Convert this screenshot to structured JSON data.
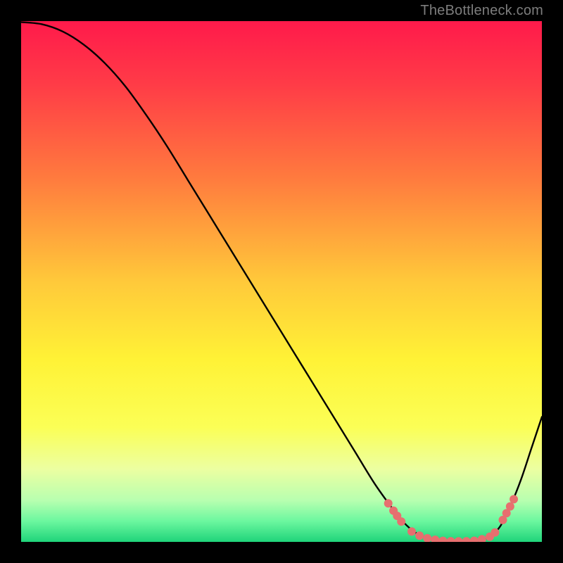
{
  "watermark": "TheBottleneck.com",
  "chart_data": {
    "type": "line",
    "title": "",
    "xlabel": "",
    "ylabel": "",
    "xlim": [
      0,
      100
    ],
    "ylim": [
      0,
      100
    ],
    "gradient_stops": [
      {
        "offset": 0.0,
        "color": "#ff1a4b"
      },
      {
        "offset": 0.12,
        "color": "#ff3b47"
      },
      {
        "offset": 0.3,
        "color": "#ff7a3e"
      },
      {
        "offset": 0.5,
        "color": "#ffc93a"
      },
      {
        "offset": 0.65,
        "color": "#fff236"
      },
      {
        "offset": 0.78,
        "color": "#fbff56"
      },
      {
        "offset": 0.86,
        "color": "#ecffa1"
      },
      {
        "offset": 0.92,
        "color": "#b8ffb0"
      },
      {
        "offset": 0.96,
        "color": "#6cf79f"
      },
      {
        "offset": 1.0,
        "color": "#1fd47a"
      }
    ],
    "series": [
      {
        "name": "bottleneck-curve",
        "x": [
          0,
          4,
          8,
          12,
          16,
          20,
          24,
          28,
          32,
          36,
          40,
          44,
          48,
          52,
          56,
          60,
          64,
          68,
          72,
          74,
          76,
          78,
          80,
          82,
          84,
          86,
          88,
          90,
          92,
          94,
          96,
          98,
          100
        ],
        "y": [
          99.8,
          99.4,
          98.0,
          95.5,
          92.0,
          87.5,
          82.0,
          76.0,
          69.5,
          63.0,
          56.5,
          50.0,
          43.5,
          37.0,
          30.5,
          24.0,
          17.5,
          11.0,
          5.5,
          3.2,
          1.6,
          0.7,
          0.25,
          0.1,
          0.1,
          0.15,
          0.35,
          1.0,
          3.0,
          7.0,
          12.0,
          18.0,
          24.0
        ]
      }
    ],
    "marker_points": {
      "name": "highlight-points",
      "color": "#e76f6f",
      "radius": 6,
      "points": [
        {
          "x": 70.5,
          "y": 7.4
        },
        {
          "x": 71.5,
          "y": 6.0
        },
        {
          "x": 72.2,
          "y": 5.0
        },
        {
          "x": 73.0,
          "y": 3.9
        },
        {
          "x": 75.0,
          "y": 2.0
        },
        {
          "x": 76.5,
          "y": 1.2
        },
        {
          "x": 78.0,
          "y": 0.7
        },
        {
          "x": 79.5,
          "y": 0.4
        },
        {
          "x": 81.0,
          "y": 0.2
        },
        {
          "x": 82.5,
          "y": 0.12
        },
        {
          "x": 84.0,
          "y": 0.1
        },
        {
          "x": 85.5,
          "y": 0.12
        },
        {
          "x": 87.0,
          "y": 0.22
        },
        {
          "x": 88.5,
          "y": 0.5
        },
        {
          "x": 90.0,
          "y": 1.0
        },
        {
          "x": 91.0,
          "y": 1.8
        },
        {
          "x": 92.5,
          "y": 4.2
        },
        {
          "x": 93.2,
          "y": 5.5
        },
        {
          "x": 93.9,
          "y": 6.8
        },
        {
          "x": 94.6,
          "y": 8.2
        }
      ]
    }
  }
}
